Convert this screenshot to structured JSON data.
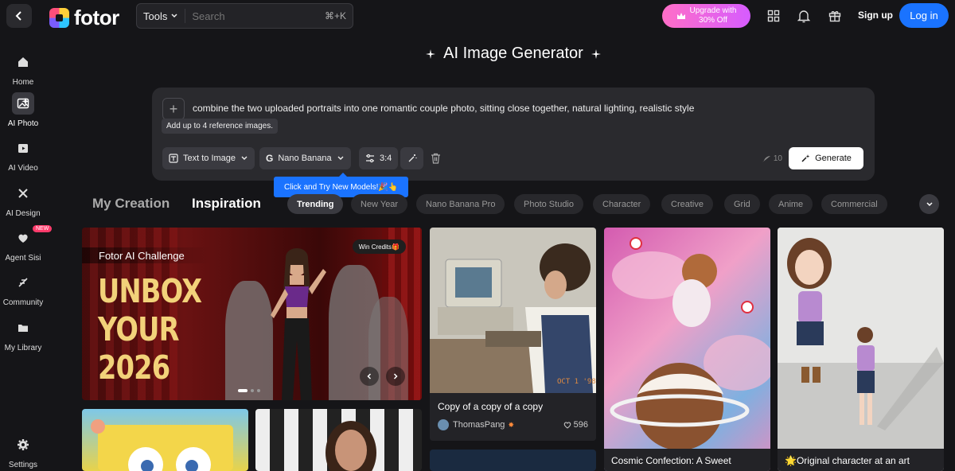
{
  "header": {
    "logo_text": "fotor",
    "tools_label": "Tools",
    "search_placeholder": "Search",
    "search_shortcut": "⌘+K",
    "upgrade_line1": "Upgrade with",
    "upgrade_line2": "30% Off",
    "signup_label": "Sign up",
    "login_label": "Log in"
  },
  "sidebar": {
    "items": [
      {
        "label": "Home",
        "icon": "home-icon"
      },
      {
        "label": "AI Photo",
        "icon": "ai-photo-icon"
      },
      {
        "label": "AI Video",
        "icon": "ai-video-icon"
      },
      {
        "label": "AI Design",
        "icon": "ai-design-icon"
      },
      {
        "label": "Agent Sisi",
        "icon": "agent-icon",
        "badge": "NEW"
      },
      {
        "label": "Community",
        "icon": "community-icon"
      },
      {
        "label": "My Library",
        "icon": "folder-icon"
      },
      {
        "label": "Settings",
        "icon": "gear-icon"
      }
    ]
  },
  "generator": {
    "title": "AI Image Generator",
    "prompt": "combine the two uploaded portraits into one romantic couple photo, sitting close together, natural lighting, realistic style",
    "add_tooltip": "Add up to 4 reference images.",
    "mode_label": "Text to Image",
    "model_label": "Nano Banana",
    "ratio_label": "3:4",
    "credits": "10",
    "generate_label": "Generate",
    "model_tooltip": "Click and Try New Models!🎉👆"
  },
  "tabs": {
    "my_creation": "My Creation",
    "inspiration": "Inspiration",
    "chips": [
      "Trending",
      "New Year",
      "Nano Banana Pro",
      "Photo Studio",
      "Character",
      "Creative",
      "Grid",
      "Anime",
      "Commercial"
    ]
  },
  "cards": {
    "banner": {
      "challenge": "Fotor AI Challenge",
      "headline_1": "UNBOX",
      "headline_2": "YOUR",
      "headline_3": "2026",
      "win_credits": "Win Credits🎁"
    },
    "painter": {
      "title": "Copy of a copy of a copy",
      "author": "ThomasPang",
      "likes": "596",
      "stamp": "OCT 1 '98"
    },
    "cosmic": {
      "title": "Cosmic Confection: A Sweet"
    },
    "character": {
      "title": "🌟Original character at an art"
    }
  },
  "colors": {
    "accent": "#1a73ff",
    "background": "#151518",
    "upgrade_gradient_start": "#ff6ec7",
    "upgrade_gradient_end": "#d65cff"
  }
}
